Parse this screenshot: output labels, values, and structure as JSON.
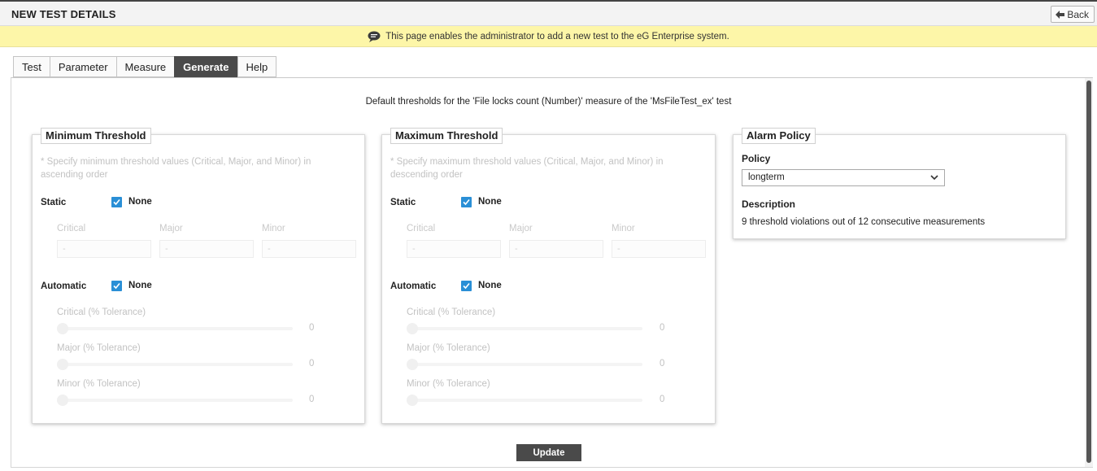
{
  "header": {
    "title": "NEW TEST DETAILS",
    "back_label": "Back"
  },
  "info": {
    "message": "This page enables the administrator to add a new test to the eG Enterprise system."
  },
  "tabs": [
    {
      "label": "Test",
      "active": false
    },
    {
      "label": "Parameter",
      "active": false
    },
    {
      "label": "Measure",
      "active": false
    },
    {
      "label": "Generate",
      "active": true
    },
    {
      "label": "Help",
      "active": false
    }
  ],
  "subtitle": "Default thresholds for the 'File locks count (Number)' measure of the 'MsFileTest_ex' test",
  "min_threshold": {
    "title": "Minimum Threshold",
    "hint": "* Specify minimum threshold values (Critical, Major, and Minor) in ascending order",
    "static_label": "Static",
    "static_none_label": "None",
    "static_none_checked": true,
    "columns": [
      "Critical",
      "Major",
      "Minor"
    ],
    "values": [
      "-",
      "-",
      "-"
    ],
    "automatic_label": "Automatic",
    "automatic_none_label": "None",
    "automatic_none_checked": true,
    "tolerances": [
      {
        "label": "Critical (% Tolerance)",
        "value": "0"
      },
      {
        "label": "Major (% Tolerance)",
        "value": "0"
      },
      {
        "label": "Minor (% Tolerance)",
        "value": "0"
      }
    ]
  },
  "max_threshold": {
    "title": "Maximum Threshold",
    "hint": "* Specify maximum threshold values (Critical, Major, and Minor) in descending order",
    "static_label": "Static",
    "static_none_label": "None",
    "static_none_checked": true,
    "columns": [
      "Critical",
      "Major",
      "Minor"
    ],
    "values": [
      "-",
      "-",
      "-"
    ],
    "automatic_label": "Automatic",
    "automatic_none_label": "None",
    "automatic_none_checked": true,
    "tolerances": [
      {
        "label": "Critical (% Tolerance)",
        "value": "0"
      },
      {
        "label": "Major (% Tolerance)",
        "value": "0"
      },
      {
        "label": "Minor (% Tolerance)",
        "value": "0"
      }
    ]
  },
  "alarm_policy": {
    "title": "Alarm Policy",
    "policy_label": "Policy",
    "policy_value": "longterm",
    "description_label": "Description",
    "description": "9 threshold violations out of 12 consecutive measurements"
  },
  "update_label": "Update",
  "colors": {
    "info_bg": "#fdf6a8",
    "active_tab": "#4a4a4a",
    "checkbox": "#2a8fd6"
  }
}
